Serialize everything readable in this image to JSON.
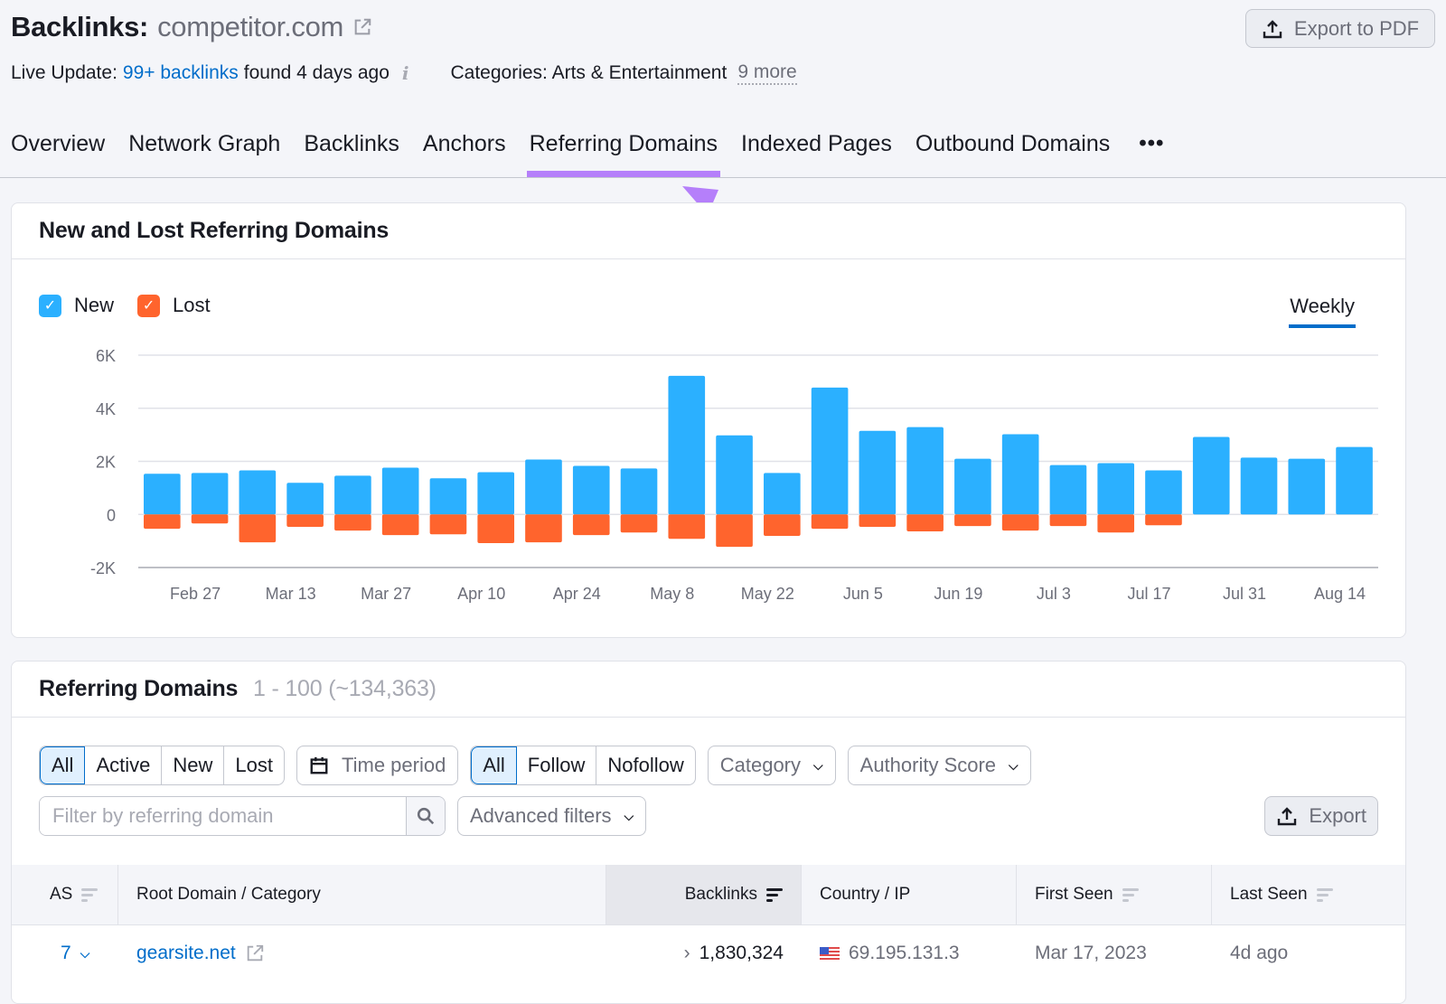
{
  "header": {
    "title_prefix": "Backlinks:",
    "domain": "competitor.com",
    "live_update_label": "Live Update:",
    "live_update_link": "99+ backlinks",
    "live_update_suffix": "found 4 days ago",
    "categories_label": "Categories: Arts & Entertainment",
    "categories_more": "9 more",
    "export_pdf": "Export to PDF"
  },
  "tabs": [
    {
      "label": "Overview",
      "active": false
    },
    {
      "label": "Network Graph",
      "active": false
    },
    {
      "label": "Backlinks",
      "active": false
    },
    {
      "label": "Anchors",
      "active": false
    },
    {
      "label": "Referring Domains",
      "active": true
    },
    {
      "label": "Indexed Pages",
      "active": false
    },
    {
      "label": "Outbound Domains",
      "active": false
    }
  ],
  "tabs_more": "•••",
  "chart_card": {
    "title": "New and Lost Referring Domains",
    "legend": [
      {
        "label": "New",
        "color": "#2bb0ff",
        "checked": true
      },
      {
        "label": "Lost",
        "color": "#ff642d",
        "checked": true
      }
    ],
    "period": "Weekly"
  },
  "chart_data": {
    "type": "bar",
    "title": "New and Lost Referring Domains",
    "xlabel": "",
    "ylabel": "",
    "ylim": [
      -2000,
      6000
    ],
    "yticks": [
      6000,
      4000,
      2000,
      0,
      -2000
    ],
    "ytick_labels": [
      "6K",
      "4K",
      "2K",
      "0",
      "-2K"
    ],
    "xtick_labels": [
      "Feb 27",
      "Mar 13",
      "Mar 27",
      "Apr 10",
      "Apr 24",
      "May 8",
      "May 22",
      "Jun 5",
      "Jun 19",
      "Jul 3",
      "Jul 17",
      "Jul 31",
      "Aug 14"
    ],
    "grid": true,
    "legend_position": "top-left",
    "series": [
      {
        "name": "New",
        "color": "#2bb0ff",
        "values": [
          1530,
          1560,
          1660,
          1190,
          1460,
          1760,
          1360,
          1590,
          2070,
          1830,
          1730,
          5220,
          2980,
          1560,
          4780,
          3150,
          3290,
          2100,
          3020,
          1860,
          1930,
          1660,
          2920,
          2140,
          2100,
          2540
        ]
      },
      {
        "name": "Lost",
        "color": "#ff642d",
        "values": [
          -540,
          -340,
          -1050,
          -470,
          -610,
          -780,
          -750,
          -1080,
          -1050,
          -780,
          -680,
          -920,
          -1220,
          -810,
          -540,
          -470,
          -640,
          -440,
          -610,
          -440,
          -680,
          -410,
          0,
          0,
          0,
          0
        ]
      }
    ]
  },
  "domains_card": {
    "title": "Referring Domains",
    "count": "1 - 100 (~134,363)",
    "status_filter": [
      {
        "label": "All",
        "selected": true
      },
      {
        "label": "Active",
        "selected": false
      },
      {
        "label": "New",
        "selected": false
      },
      {
        "label": "Lost",
        "selected": false
      }
    ],
    "time_period": "Time period",
    "follow_filter": [
      {
        "label": "All",
        "selected": true
      },
      {
        "label": "Follow",
        "selected": false
      },
      {
        "label": "Nofollow",
        "selected": false
      }
    ],
    "category": "Category",
    "authority_score": "Authority Score",
    "search_placeholder": "Filter by referring domain",
    "advanced_filters": "Advanced filters",
    "export": "Export",
    "columns": [
      "AS",
      "Root Domain / Category",
      "Backlinks",
      "Country / IP",
      "First Seen",
      "Last Seen"
    ],
    "rows": [
      {
        "as": "7",
        "domain": "gearsite.net",
        "backlinks": "1,830,324",
        "ip": "69.195.131.3",
        "first_seen": "Mar 17, 2023",
        "last_seen": "4d ago"
      }
    ]
  }
}
